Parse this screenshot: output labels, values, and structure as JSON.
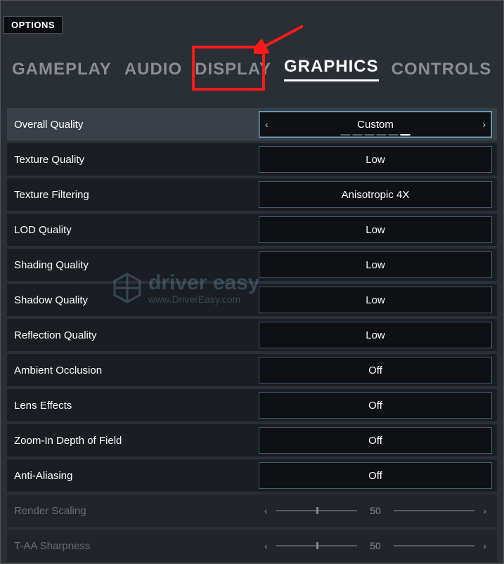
{
  "header": {
    "options_label": "OPTIONS"
  },
  "tabs": [
    {
      "label": "GAMEPLAY",
      "active": false
    },
    {
      "label": "AUDIO",
      "active": false
    },
    {
      "label": "DISPLAY",
      "active": false
    },
    {
      "label": "GRAPHICS",
      "active": true
    },
    {
      "label": "CONTROLS",
      "active": false
    }
  ],
  "settings": [
    {
      "label": "Overall Quality",
      "value": "Custom",
      "type": "select-arrows",
      "highlight": true
    },
    {
      "label": "Texture Quality",
      "value": "Low",
      "type": "select"
    },
    {
      "label": "Texture Filtering",
      "value": "Anisotropic 4X",
      "type": "select"
    },
    {
      "label": "LOD Quality",
      "value": "Low",
      "type": "select"
    },
    {
      "label": "Shading Quality",
      "value": "Low",
      "type": "select"
    },
    {
      "label": "Shadow Quality",
      "value": "Low",
      "type": "select"
    },
    {
      "label": "Reflection Quality",
      "value": "Low",
      "type": "select"
    },
    {
      "label": "Ambient Occlusion",
      "value": "Off",
      "type": "select"
    },
    {
      "label": "Lens Effects",
      "value": "Off",
      "type": "select"
    },
    {
      "label": "Zoom-In Depth of Field",
      "value": "Off",
      "type": "select"
    },
    {
      "label": "Anti-Aliasing",
      "value": "Off",
      "type": "select"
    },
    {
      "label": "Render Scaling",
      "value": "50",
      "type": "slider",
      "disabled": true,
      "percent": 50
    },
    {
      "label": "T-AA Sharpness",
      "value": "50",
      "type": "slider",
      "disabled": true,
      "percent": 50
    }
  ],
  "watermark": {
    "brand": "driver easy",
    "url": "www.DriverEasy.com"
  },
  "glyphs": {
    "chev_left": "‹",
    "chev_right": "›"
  }
}
